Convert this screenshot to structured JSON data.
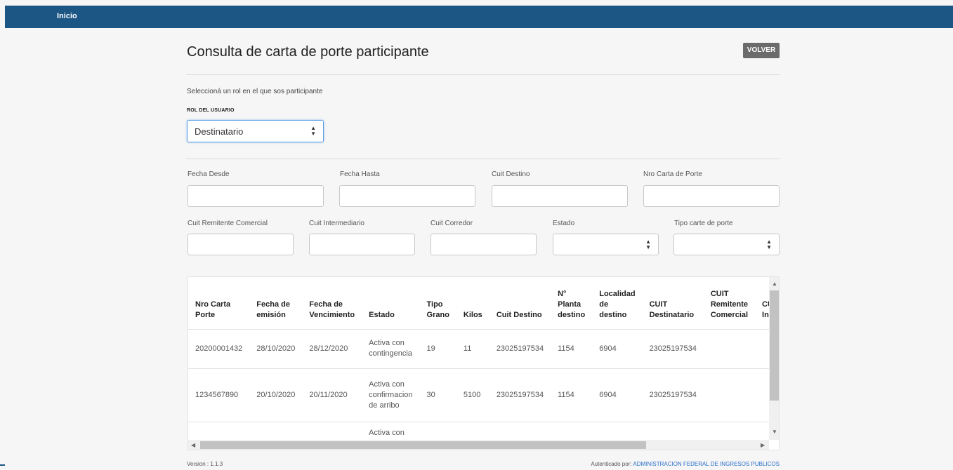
{
  "nav": {
    "home_label": "Inicio"
  },
  "page": {
    "title": "Consulta de carta de porte participante",
    "back_button": "VOLVER",
    "role_prompt": "Seleccioná un rol en el que sos participante",
    "role_label": "ROL DEL USUARIO",
    "role_value": "Destinatario"
  },
  "filters": {
    "fecha_desde": "Fecha Desde",
    "fecha_hasta": "Fecha Hasta",
    "cuit_destino": "Cuit Destino",
    "nro_carta": "Nro Carta de Porte",
    "cuit_remitente": "Cuit Remitente Comercial",
    "cuit_intermediario": "Cuit Intermediario",
    "cuit_corredor": "Cuit Corredor",
    "estado": "Estado",
    "tipo_carta": "Tipo carte de porte"
  },
  "table": {
    "headers": [
      "Nro Carta Porte",
      "Fecha de emisión",
      "Fecha de Vencimiento",
      "Estado",
      "Tipo Grano",
      "Kilos",
      "Cuit Destino",
      "N° Planta destino",
      "Localidad de destino",
      "CUIT Destinatario",
      "CUIT Remitente Comercial",
      "CUIT Intermediario"
    ],
    "rows": [
      [
        "20200001432",
        "28/10/2020",
        "28/12/2020",
        "Activa con contingencia",
        "19",
        "11",
        "23025197534",
        "1154",
        "6904",
        "23025197534",
        "",
        ""
      ],
      [
        "1234567890",
        "20/10/2020",
        "20/11/2020",
        "Activa con confirmacion de arribo",
        "30",
        "5100",
        "23025197534",
        "1154",
        "6904",
        "23025197534",
        "",
        ""
      ],
      [
        "",
        "",
        "",
        "Activa con",
        "",
        "",
        "",
        "",
        "",
        "",
        "",
        ""
      ]
    ]
  },
  "footer": {
    "version": "Version : 1.1.3",
    "auth_prefix": "Autenticado por:",
    "auth_entity": "ADMINISTRACION FEDERAL DE INGRESOS PUBLICOS"
  },
  "colors": {
    "topbar": "#1c5685",
    "button": "#6b6b6b",
    "link": "#2a6fc9"
  }
}
